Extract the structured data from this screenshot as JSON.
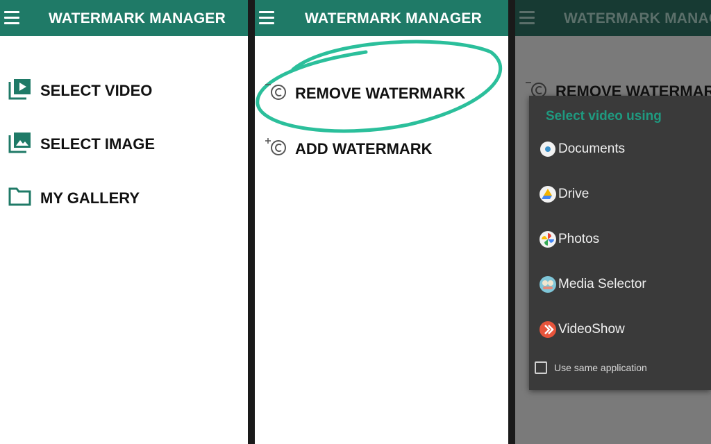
{
  "panel1": {
    "title": "WATERMARK MANAGER",
    "items": [
      {
        "label": "SELECT VIDEO",
        "icon": "video-library-icon"
      },
      {
        "label": "SELECT IMAGE",
        "icon": "photo-library-icon"
      },
      {
        "label": "MY GALLERY",
        "icon": "folder-icon"
      }
    ]
  },
  "panel2": {
    "title": "WATERMARK MANAGER",
    "items": [
      {
        "label": "REMOVE WATERMARK",
        "icon": "remove-copyright-icon"
      },
      {
        "label": "ADD WATERMARK",
        "icon": "add-copyright-icon"
      }
    ]
  },
  "panel3": {
    "title": "WATERMARK MANAGER",
    "background_item": "REMOVE WATERMARK",
    "dialog": {
      "title": "Select video using",
      "options": [
        {
          "label": "Documents",
          "icon": "documents-icon"
        },
        {
          "label": "Drive",
          "icon": "drive-icon"
        },
        {
          "label": "Photos",
          "icon": "photos-icon"
        },
        {
          "label": "Media Selector",
          "icon": "media-selector-icon"
        },
        {
          "label": "VideoShow",
          "icon": "videoshow-icon"
        }
      ],
      "checkbox_label": "Use same application",
      "checkbox_checked": false
    }
  },
  "colors": {
    "appbar": "#1f7a67",
    "accent": "#1f9a80",
    "highlight_circle": "#2bbf9b"
  }
}
